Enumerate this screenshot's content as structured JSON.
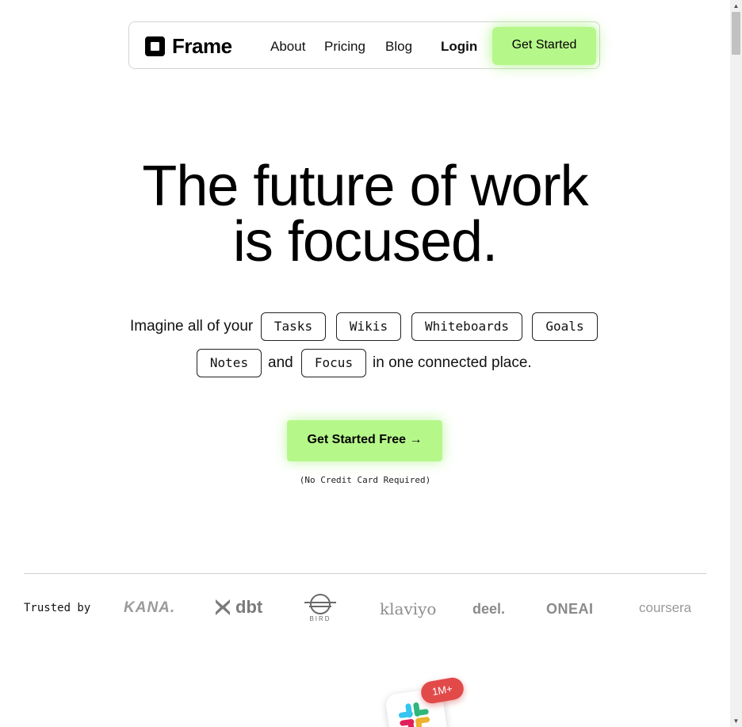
{
  "nav": {
    "logo_text": "Frame",
    "links": [
      "About",
      "Pricing",
      "Blog"
    ],
    "login": "Login",
    "cta": "Get Started"
  },
  "hero": {
    "title_line1": "The future of work",
    "title_line2": "is focused.",
    "tagline_start": "Imagine all of your",
    "tagline_and": "and",
    "tagline_end": "in one connected place.",
    "chips": [
      "Tasks",
      "Wikis",
      "Whiteboards",
      "Goals",
      "Notes",
      "Focus"
    ],
    "cta": "Get Started Free →",
    "note": "(No Credit Card Required)"
  },
  "trusted": {
    "label": "Trusted by",
    "brands": [
      "KANA.",
      "dbt",
      "BIRD",
      "klaviyo",
      "deel.",
      "ONEAI",
      "coursera"
    ]
  },
  "floating": {
    "badge": "1M+"
  },
  "colors": {
    "accent": "#b6f78a",
    "badge": "#e24a4a"
  }
}
